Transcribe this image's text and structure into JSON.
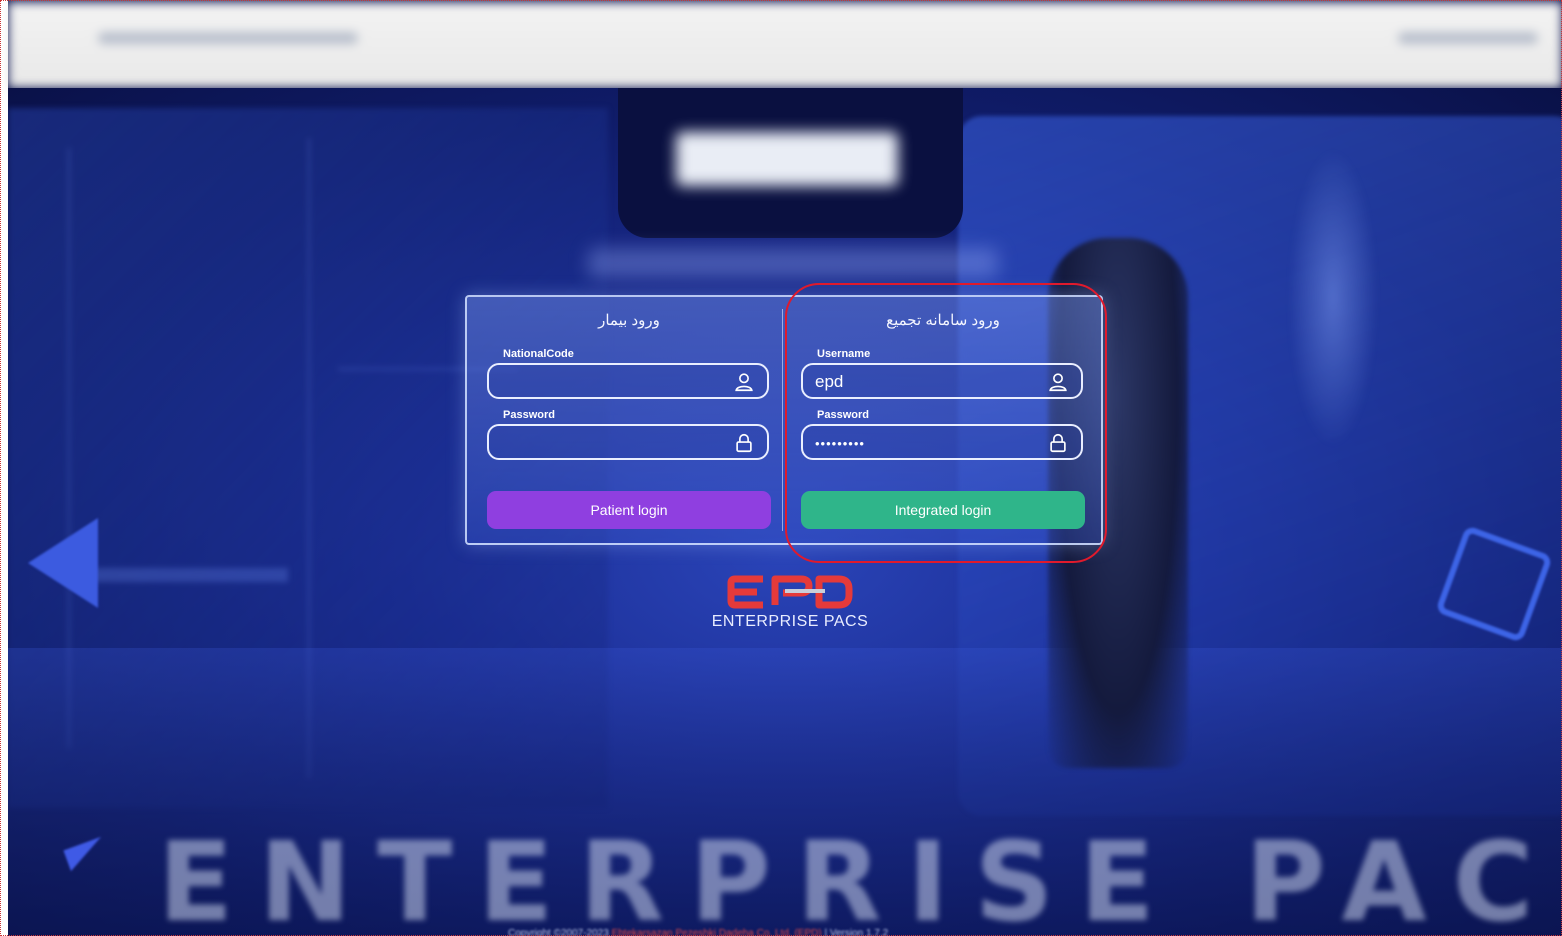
{
  "card": {
    "patient": {
      "title": "ورود بیمار",
      "national_code_label": "NationalCode",
      "national_code_value": "",
      "password_label": "Password",
      "password_value": "",
      "button_label": "Patient login",
      "button_color": "#8f3fe0"
    },
    "integrated": {
      "title": "ورود سامانه تجمیع",
      "username_label": "Username",
      "username_value": "epd",
      "password_label": "Password",
      "password_value": "•••••••••",
      "button_label": "Integrated login",
      "button_color": "#2fb58a"
    }
  },
  "brand": {
    "logo_text": "EPD",
    "product_name": "ENTERPRISE  PACS",
    "logo_color": "#e53a3a"
  },
  "watermark": "ENTERPRISE  PACS",
  "footer": {
    "copyright_prefix": "Copyright ©2007-2023",
    "company": "Ebtekarsazan Pezeshki Dadeha Co. Ltd. (EPD)",
    "version": "| Version 1.7.2"
  },
  "icons": {
    "user": "user-icon",
    "lock": "lock-icon"
  },
  "highlight_color": "#e01a2c"
}
